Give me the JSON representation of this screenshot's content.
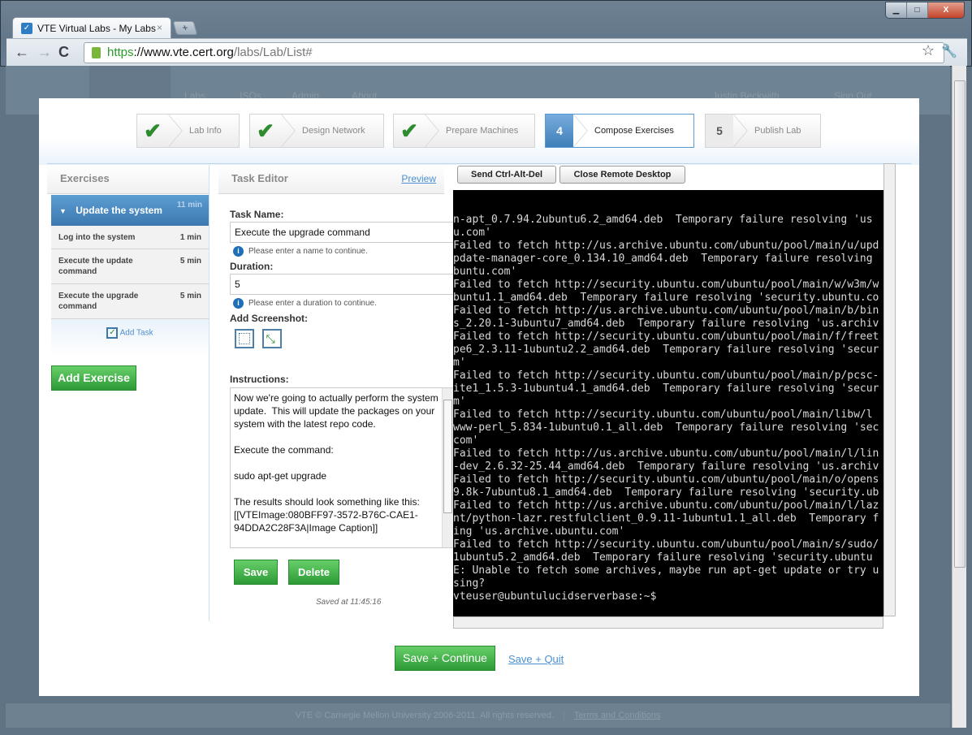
{
  "browser": {
    "tab_title": "VTE Virtual Labs - My Labs",
    "url_scheme": "https",
    "url_host": "://www.vte.cert.org",
    "url_path": "/labs/Lab/List#"
  },
  "site_nav": {
    "items": [
      "Labs",
      "ISOs",
      "Admin",
      "About"
    ],
    "user": "Justin Beckwith",
    "sign_out": "Sign Out"
  },
  "wizard": {
    "steps": [
      {
        "label": "Lab Info",
        "status": "done"
      },
      {
        "label": "Design Network",
        "status": "done"
      },
      {
        "label": "Prepare Machines",
        "status": "done"
      },
      {
        "number": "4",
        "label": "Compose Exercises",
        "status": "active"
      },
      {
        "number": "5",
        "label": "Publish Lab",
        "status": "todo"
      }
    ]
  },
  "exercises": {
    "header": "Exercises",
    "exercise": {
      "title": "Update the system",
      "duration": "11 min"
    },
    "tasks": [
      {
        "name": "Log into the system",
        "duration": "1 min"
      },
      {
        "name": "Execute the update command",
        "duration": "5 min"
      },
      {
        "name": "Execute the upgrade command",
        "duration": "5 min"
      }
    ],
    "add_task": "Add Task",
    "add_exercise": "Add Exercise"
  },
  "editor": {
    "header": "Task Editor",
    "preview": "Preview",
    "task_name_label": "Task Name:",
    "task_name_value": "Execute the upgrade command",
    "task_name_hint": "Please enter a name to continue.",
    "duration_label": "Duration:",
    "duration_value": "5",
    "duration_hint": "Please enter a duration to continue.",
    "screenshot_label": "Add Screenshot:",
    "instructions_label": "Instructions:",
    "instructions_value": "Now we're going to actually perform the system update.  This will update the packages on your system with the latest repo code.\n\nExecute the command:\n\nsudo apt-get upgrade\n\nThe results should look something like this:\n[[VTEImage:080BFF97-3572-B76C-CAE1-94DDA2C28F3A|Image Caption]]",
    "save": "Save",
    "delete": "Delete",
    "saved_status": "Saved at 11:45:16"
  },
  "remote": {
    "ctrl_alt_del": "Send Ctrl-Alt-Del",
    "close": "Close Remote Desktop",
    "terminal": "n-apt_0.7.94.2ubuntu6.2_amd64.deb  Temporary failure resolving 'us\nu.com'\nFailed to fetch http://us.archive.ubuntu.com/ubuntu/pool/main/u/upd\npdate-manager-core_0.134.10_amd64.deb  Temporary failure resolving\nbuntu.com'\nFailed to fetch http://security.ubuntu.com/ubuntu/pool/main/w/w3m/w\nbuntu1.1_amd64.deb  Temporary failure resolving 'security.ubuntu.co\nFailed to fetch http://us.archive.ubuntu.com/ubuntu/pool/main/b/bin\ns_2.20.1-3ubuntu7_amd64.deb  Temporary failure resolving 'us.archiv\nFailed to fetch http://security.ubuntu.com/ubuntu/pool/main/f/freet\npe6_2.3.11-1ubuntu2.2_amd64.deb  Temporary failure resolving 'secur\nm'\nFailed to fetch http://security.ubuntu.com/ubuntu/pool/main/p/pcsc-\nite1_1.5.3-1ubuntu4.1_amd64.deb  Temporary failure resolving 'secur\nm'\nFailed to fetch http://security.ubuntu.com/ubuntu/pool/main/libw/l\nwww-perl_5.834-1ubuntu0.1_all.deb  Temporary failure resolving 'sec\ncom'\nFailed to fetch http://us.archive.ubuntu.com/ubuntu/pool/main/l/lin\n-dev_2.6.32-25.44_amd64.deb  Temporary failure resolving 'us.archiv\nFailed to fetch http://security.ubuntu.com/ubuntu/pool/main/o/opens\n9.8k-7ubuntu8.1_amd64.deb  Temporary failure resolving 'security.ub\nFailed to fetch http://us.archive.ubuntu.com/ubuntu/pool/main/l/laz\nnt/python-lazr.restfulclient_0.9.11-1ubuntu1.1_all.deb  Temporary f\ning 'us.archive.ubuntu.com'\nFailed to fetch http://security.ubuntu.com/ubuntu/pool/main/s/sudo/\n1ubuntu5.2_amd64.deb  Temporary failure resolving 'security.ubuntu\nE: Unable to fetch some archives, maybe run apt-get update or try u\nsing?\nvteuser@ubuntulucidserverbase:~$"
  },
  "actions": {
    "save_continue": "Save + Continue",
    "save_quit": "Save + Quit"
  },
  "footer": {
    "copyright": "VTE © Carnegie Mellon University 2006-2011. All rights reserved.",
    "terms": "Terms and Conditions"
  },
  "colors": {
    "accent_blue": "#3c79b0",
    "green": "#2c9a36",
    "link": "#4a90d0"
  }
}
